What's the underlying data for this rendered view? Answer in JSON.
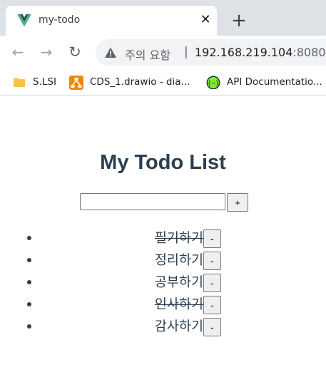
{
  "browser": {
    "tab": {
      "title": "my-todo",
      "favicon": "vue-logo-icon",
      "close_glyph": "✕"
    },
    "new_tab_glyph": "+",
    "toolbar": {
      "back_glyph": "←",
      "forward_glyph": "→",
      "reload_glyph": "↻",
      "security_label": "주의 요함",
      "separator": "|",
      "url_host": "192.168.219.104",
      "url_port": ":8080"
    },
    "bookmarks": [
      {
        "label": "S.LSI",
        "icon": "folder-icon"
      },
      {
        "label": "CDS_1.drawio - dia...",
        "icon": "drawio-icon"
      },
      {
        "label": "API Documentatio...",
        "icon": "swagger-icon"
      }
    ]
  },
  "app": {
    "title": "My Todo List",
    "input": {
      "value": "",
      "placeholder": ""
    },
    "add_label": "+",
    "remove_label": "-",
    "todos": [
      {
        "text": "필기하기",
        "done": true
      },
      {
        "text": "정리하기",
        "done": false
      },
      {
        "text": "공부하기",
        "done": false
      },
      {
        "text": "인사하기",
        "done": true
      },
      {
        "text": "감사하기",
        "done": false
      }
    ]
  },
  "colors": {
    "accent_text": "#2c3e50",
    "vue_green": "#41b883",
    "vue_dark": "#35495e",
    "tabstrip": "#dee1e6"
  }
}
